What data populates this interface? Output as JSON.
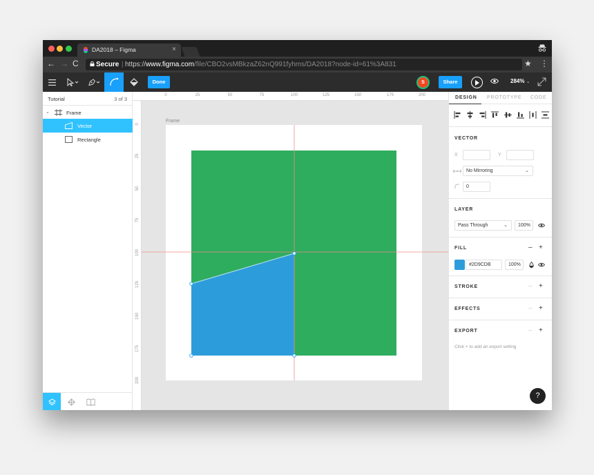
{
  "browser": {
    "tab_title": "DA2018 – Figma",
    "tab_close": "×",
    "secure_label": "Secure",
    "url_scheme": "https://",
    "url_host": "www.figma.com",
    "url_path": "/file/CBO2vsMBkzaZ62nQ991fyhms/DA2018?node-id=61%3A831",
    "back": "←",
    "forward": "→",
    "reload": "C",
    "star": "★",
    "menu": "⋮"
  },
  "toolbar": {
    "done_label": "Done",
    "avatar_initial": "S",
    "share_label": "Share",
    "zoom_label": "284%",
    "zoom_caret": "⌄"
  },
  "layers": {
    "page_name": "Tutorial",
    "page_count": "3 of 3",
    "caret": "⌄",
    "items": [
      {
        "label": "Frame",
        "icon": "frame-icon"
      },
      {
        "label": "Vector",
        "icon": "vector-icon",
        "selected": true
      },
      {
        "label": "Rectangle",
        "icon": "rectangle-icon"
      }
    ]
  },
  "canvas": {
    "frame_label": "Frame",
    "ruler_x": [
      "0",
      "25",
      "50",
      "75",
      "100",
      "125",
      "150",
      "175",
      "200"
    ],
    "ruler_y": [
      "0",
      "25",
      "50",
      "75",
      "100",
      "125",
      "150",
      "175",
      "200"
    ],
    "green_fill": "#2EAD5E",
    "blue_fill": "#2D9CDB"
  },
  "design": {
    "tabs": [
      "DESIGN",
      "PROTOTYPE",
      "CODE"
    ],
    "vector_title": "VECTOR",
    "x_label": "X",
    "y_label": "Y",
    "mirroring": "No Mirroring",
    "radius": "0",
    "layer_title": "LAYER",
    "blend_mode": "Pass Through",
    "layer_opacity": "100%",
    "fill_title": "FILL",
    "fill_hex": "#2D9CDB",
    "fill_opacity": "100%",
    "stroke_title": "STROKE",
    "effects_title": "EFFECTS",
    "export_title": "EXPORT",
    "export_hint": "Click + to add an export setting",
    "minus": "–",
    "plus": "+",
    "help": "?"
  },
  "colors": {
    "accent": "#18A0FB",
    "selection": "#30C2FF",
    "toolbar_bg": "#2C2C2C",
    "guide": "#F08B8B"
  }
}
